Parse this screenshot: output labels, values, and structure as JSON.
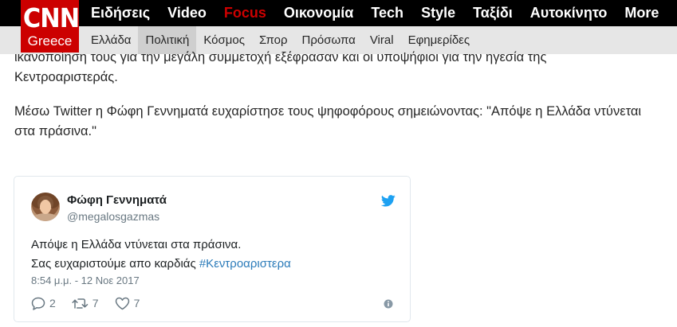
{
  "logo": {
    "brand": "CNN",
    "edition": "Greece"
  },
  "main_nav": [
    {
      "label": "Ειδήσεις",
      "active": false
    },
    {
      "label": "Video",
      "active": false
    },
    {
      "label": "Focus",
      "active": true
    },
    {
      "label": "Οικονομία",
      "active": false
    },
    {
      "label": "Tech",
      "active": false
    },
    {
      "label": "Style",
      "active": false
    },
    {
      "label": "Ταξίδι",
      "active": false
    },
    {
      "label": "Αυτοκίνητο",
      "active": false
    },
    {
      "label": "More",
      "active": false
    }
  ],
  "sub_nav": [
    {
      "label": "Ελλάδα",
      "active": false
    },
    {
      "label": "Πολιτική",
      "active": true
    },
    {
      "label": "Κόσμος",
      "active": false
    },
    {
      "label": "Σπορ",
      "active": false
    },
    {
      "label": "Πρόσωπα",
      "active": false
    },
    {
      "label": "Viral",
      "active": false
    },
    {
      "label": "Εφημερίδες",
      "active": false
    }
  ],
  "article": {
    "paragraph_1": "ικανοποίηση τους για την μεγάλη συμμετοχή εξέφρασαν και οι υποψήφιοι για την ηγεσία της Κεντροαριστεράς.",
    "paragraph_2": "Μέσω Twitter η Φώφη Γεννηματά ευχαρίστησε τους ψηφοφόρους σημειώνοντας: \"Απόψε η Ελλάδα ντύνεται στα πράσινα.\""
  },
  "tweet": {
    "author_name": "Φώφη Γεννηματά",
    "author_handle": "@megalosgazmas",
    "text_line_1": "Απόψε η Ελλάδα ντύνεται στα πράσινα.",
    "text_line_2": "Σας ευχαριστούμε απο καρδιάς ",
    "hashtag": "#Κεντροαριστερα",
    "timestamp": "8:54 μ.μ. - 12 Νοε 2017",
    "replies": "2",
    "retweets": "7",
    "likes": "7"
  },
  "icons": {
    "twitter_bird": "twitter-bird-icon",
    "reply": "reply-icon",
    "retweet": "retweet-icon",
    "like": "heart-icon",
    "info": "info-icon"
  },
  "colors": {
    "brand_red": "#cc0000",
    "focus_red": "#cc0000",
    "twitter_blue": "#1da1f2",
    "hashtag_blue": "#2b7bb9"
  }
}
